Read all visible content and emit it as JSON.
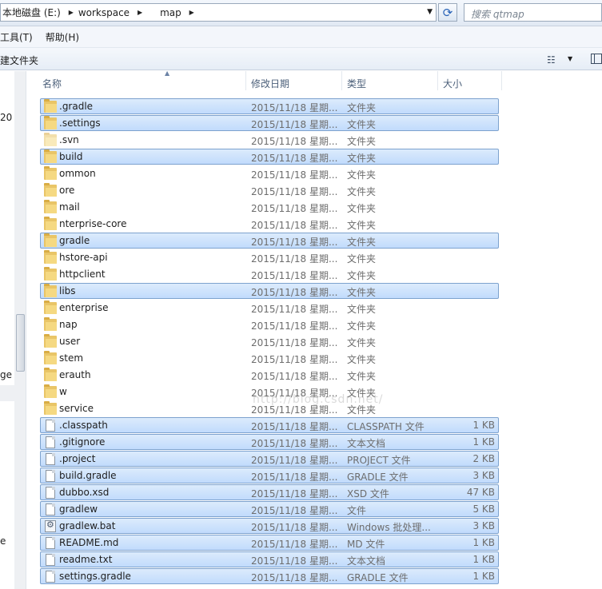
{
  "address": {
    "segments": [
      "本地磁盘 (E:)",
      "workspace",
      "map"
    ],
    "search_placeholder": "搜索 qtmap"
  },
  "menu": [
    "工具(T)",
    "帮助(H)"
  ],
  "toolbar": {
    "new_folder": "建文件夹"
  },
  "nav": {
    "texts": [
      "20",
      "ge",
      "e"
    ]
  },
  "columns": {
    "name": "名称",
    "date": "修改日期",
    "type": "类型",
    "size": "大小"
  },
  "files": [
    {
      "name": ".gradle",
      "date": "2015/11/18 星期...",
      "type": "文件夹",
      "size": "",
      "kind": "folder",
      "selected": true
    },
    {
      "name": ".settings",
      "date": "2015/11/18 星期...",
      "type": "文件夹",
      "size": "",
      "kind": "folder",
      "selected": true
    },
    {
      "name": ".svn",
      "date": "2015/11/18 星期...",
      "type": "文件夹",
      "size": "",
      "kind": "folder-ghost",
      "selected": false
    },
    {
      "name": "build",
      "date": "2015/11/18 星期...",
      "type": "文件夹",
      "size": "",
      "kind": "folder",
      "selected": true
    },
    {
      "name": "ommon",
      "date": "2015/11/18 星期...",
      "type": "文件夹",
      "size": "",
      "kind": "folder",
      "selected": false
    },
    {
      "name": "ore",
      "date": "2015/11/18 星期...",
      "type": "文件夹",
      "size": "",
      "kind": "folder",
      "selected": false
    },
    {
      "name": "mail",
      "date": "2015/11/18 星期...",
      "type": "文件夹",
      "size": "",
      "kind": "folder",
      "selected": false
    },
    {
      "name": "nterprise-core",
      "date": "2015/11/18 星期...",
      "type": "文件夹",
      "size": "",
      "kind": "folder",
      "selected": false
    },
    {
      "name": "gradle",
      "date": "2015/11/18 星期...",
      "type": "文件夹",
      "size": "",
      "kind": "folder",
      "selected": true
    },
    {
      "name": "hstore-api",
      "date": "2015/11/18 星期...",
      "type": "文件夹",
      "size": "",
      "kind": "folder",
      "selected": false
    },
    {
      "name": "httpclient",
      "date": "2015/11/18 星期...",
      "type": "文件夹",
      "size": "",
      "kind": "folder",
      "selected": false
    },
    {
      "name": "libs",
      "date": "2015/11/18 星期...",
      "type": "文件夹",
      "size": "",
      "kind": "folder",
      "selected": true
    },
    {
      "name": "enterprise",
      "date": "2015/11/18 星期...",
      "type": "文件夹",
      "size": "",
      "kind": "folder",
      "selected": false
    },
    {
      "name": "nap",
      "date": "2015/11/18 星期...",
      "type": "文件夹",
      "size": "",
      "kind": "folder",
      "selected": false
    },
    {
      "name": "user",
      "date": "2015/11/18 星期...",
      "type": "文件夹",
      "size": "",
      "kind": "folder",
      "selected": false
    },
    {
      "name": "stem",
      "date": "2015/11/18 星期...",
      "type": "文件夹",
      "size": "",
      "kind": "folder",
      "selected": false
    },
    {
      "name": "erauth",
      "date": "2015/11/18 星期...",
      "type": "文件夹",
      "size": "",
      "kind": "folder",
      "selected": false
    },
    {
      "name": "w",
      "date": "2015/11/18 星期...",
      "type": "文件夹",
      "size": "",
      "kind": "folder",
      "selected": false
    },
    {
      "name": "service",
      "date": "2015/11/18 星期...",
      "type": "文件夹",
      "size": "",
      "kind": "folder",
      "selected": false
    },
    {
      "name": ".classpath",
      "date": "2015/11/18 星期...",
      "type": "CLASSPATH 文件",
      "size": "1 KB",
      "kind": "file",
      "selected": true
    },
    {
      "name": ".gitignore",
      "date": "2015/11/18 星期...",
      "type": "文本文档",
      "size": "1 KB",
      "kind": "file",
      "selected": true
    },
    {
      "name": ".project",
      "date": "2015/11/18 星期...",
      "type": "PROJECT 文件",
      "size": "2 KB",
      "kind": "file",
      "selected": true
    },
    {
      "name": "build.gradle",
      "date": "2015/11/18 星期...",
      "type": "GRADLE 文件",
      "size": "3 KB",
      "kind": "file",
      "selected": true
    },
    {
      "name": "dubbo.xsd",
      "date": "2015/11/18 星期...",
      "type": "XSD 文件",
      "size": "47 KB",
      "kind": "file",
      "selected": true
    },
    {
      "name": "gradlew",
      "date": "2015/11/18 星期...",
      "type": "文件",
      "size": "5 KB",
      "kind": "file",
      "selected": true
    },
    {
      "name": "gradlew.bat",
      "date": "2015/11/18 星期...",
      "type": "Windows 批处理...",
      "size": "3 KB",
      "kind": "bat",
      "selected": true
    },
    {
      "name": "README.md",
      "date": "2015/11/18 星期...",
      "type": "MD 文件",
      "size": "1 KB",
      "kind": "file",
      "selected": true
    },
    {
      "name": "readme.txt",
      "date": "2015/11/18 星期...",
      "type": "文本文档",
      "size": "1 KB",
      "kind": "file",
      "selected": true
    },
    {
      "name": "settings.gradle",
      "date": "2015/11/18 星期...",
      "type": "GRADLE 文件",
      "size": "1 KB",
      "kind": "file",
      "selected": true
    }
  ],
  "watermark": "http://blog.csdn.net/"
}
